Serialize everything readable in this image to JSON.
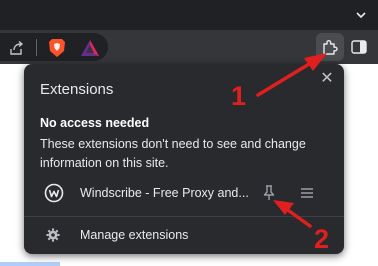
{
  "browser": {
    "toolbar_icons": [
      "share-icon",
      "brave-shields-icon",
      "brave-rewards-icon",
      "extensions-puzzle-icon",
      "side-panel-icon"
    ]
  },
  "extensions_popup": {
    "title": "Extensions",
    "close_icon": "close-icon",
    "close_glyph": "✕",
    "section_heading": "No access needed",
    "section_description": "These extensions don't need to see and change information on this site.",
    "extensions": [
      {
        "name": "Windscribe - Free Proxy and...",
        "icon": "windscribe-logo-icon",
        "pin_icon": "pin-icon",
        "menu_icon": "more-menu-icon"
      }
    ],
    "manage_label": "Manage extensions",
    "manage_icon": "gear-icon"
  },
  "annotations": {
    "step1": "1",
    "step2": "2",
    "color": "#e01f1f"
  },
  "colors": {
    "popup_bg": "#292a2d",
    "toolbar_bg": "#35363a",
    "titlebar_bg": "#202124",
    "brave_orange": "#fb542b",
    "rewards_purple": "#662d91"
  }
}
